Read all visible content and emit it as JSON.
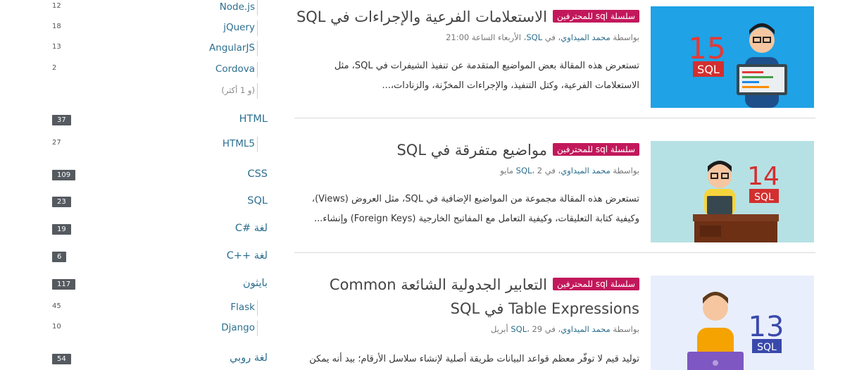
{
  "sidebar": {
    "items": [
      {
        "label": "Node.js",
        "count": "12",
        "kind": "sub"
      },
      {
        "label": "jQuery",
        "count": "18",
        "kind": "sub"
      },
      {
        "label": "AngularJS",
        "count": "13",
        "kind": "sub"
      },
      {
        "label": "Cordova",
        "count": "2",
        "kind": "sub"
      },
      {
        "label": "(و 1 أكثر)",
        "count": "",
        "kind": "more"
      },
      {
        "label": "HTML",
        "count": "37",
        "kind": "main"
      },
      {
        "label": "HTML5",
        "count": "27",
        "kind": "sub"
      },
      {
        "label": "CSS",
        "count": "109",
        "kind": "main"
      },
      {
        "label": "SQL",
        "count": "23",
        "kind": "main"
      },
      {
        "label": "لغة #C",
        "count": "19",
        "kind": "main"
      },
      {
        "label": "لغة ++C",
        "count": "6",
        "kind": "main"
      },
      {
        "label": "بايثون",
        "count": "117",
        "kind": "main"
      },
      {
        "label": "Flask",
        "count": "45",
        "kind": "sub"
      },
      {
        "label": "Django",
        "count": "10",
        "kind": "sub"
      },
      {
        "label": "لغة روبي",
        "count": "54",
        "kind": "main"
      }
    ]
  },
  "articles": [
    {
      "badge": "سلسلة sql للمحترفين",
      "title": "الاستعلامات الفرعية والإجراءات في SQL",
      "meta_by": "بواسطة",
      "author": "محمد الميداوي",
      "meta_in": "، في",
      "category": "SQL",
      "date": "، الأربعاء الساعة 21:00",
      "excerpt": "تستعرض هذه المقالة بعض المواضيع المتقدمة عن تنفيذ الشيفرات في SQL، مثل الاستعلامات الفرعية، وكتل التنفيذ، والإجراءات المخزّنة، والزنادات،...",
      "thumb_number": "15",
      "thumb_label": "SQL"
    },
    {
      "badge": "سلسلة sql للمحترفين",
      "title": "مواضيع متفرقة في SQL",
      "meta_by": "بواسطة",
      "author": "محمد الميداوي",
      "meta_in": "، في",
      "category": "SQL",
      "date": "، 2 مايو",
      "excerpt": "تستعرض هذه المقالة مجموعة من المواضيع الإضافية في SQL، مثل العروض (Views)، وكيفية كتابة التعليقات، وكيفية التعامل مع المفاتيح الخارجية (Foreign Keys) وإنشاء...",
      "thumb_number": "14",
      "thumb_label": "SQL"
    },
    {
      "badge": "سلسلة sql للمحترفين",
      "title": "التعابير الجدولية الشائعة Common Table Expressions في SQL",
      "meta_by": "بواسطة",
      "author": "محمد الميداوي",
      "meta_in": "، في",
      "category": "SQL",
      "date": "، 29 أبريل",
      "excerpt": "توليد قيم لا توفّر معظم قواعد البيانات طريقة أصلية لإنشاء سلاسل الأرقام؛ بيد أنه يمكن",
      "thumb_number": "13",
      "thumb_label": "SQL"
    }
  ],
  "colors": {
    "badge": "#c2185b",
    "link": "#2c6f8f",
    "thumb_15_bg": "#1fa2e6",
    "thumb_14_bg": "#b6e1e4",
    "thumb_13_bg": "#e9eefc",
    "sql_red": "#d32f2f"
  }
}
